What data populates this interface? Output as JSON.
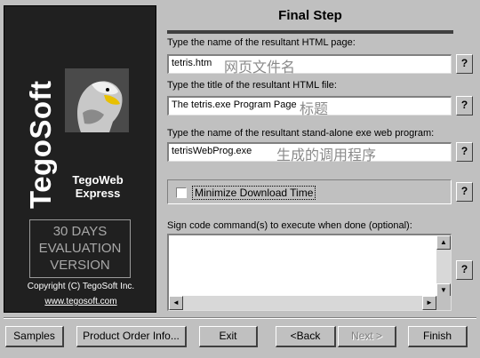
{
  "sidebar": {
    "brand": "TegoSoft",
    "product_line1": "TegoWeb",
    "product_line2": "Express",
    "eval_line1": "30 DAYS",
    "eval_line2": "EVALUATION",
    "eval_line3": "VERSION",
    "copyright": "Copyright (C) TegoSoft Inc.",
    "website": "www.tegosoft.com"
  },
  "header": {
    "title": "Final Step"
  },
  "fields": {
    "html_page": {
      "label": "Type the name of the resultant HTML page:",
      "value": "tetris.htm",
      "annotation": "网页文件名"
    },
    "html_title": {
      "label": "Type the title of the resultant HTML file:",
      "value": "The tetris.exe Program Page",
      "annotation": "标题"
    },
    "exe_program": {
      "label": "Type the name of the resultant stand-alone exe web program:",
      "value": "tetrisWebProg.exe",
      "annotation": "生成的调用程序"
    }
  },
  "help_label": "?",
  "minimize": {
    "label": "Minimize Download Time",
    "checked": false
  },
  "sign_code": {
    "label": "Sign code command(s) to execute when done (optional):",
    "value": ""
  },
  "buttons": {
    "samples": "Samples",
    "product_order": "Product Order Info...",
    "exit": "Exit",
    "back": "<Back",
    "next": "Next >",
    "finish": "Finish"
  },
  "icons": {
    "scroll_up": "▲",
    "scroll_down": "▼",
    "scroll_left": "◄",
    "scroll_right": "►"
  }
}
